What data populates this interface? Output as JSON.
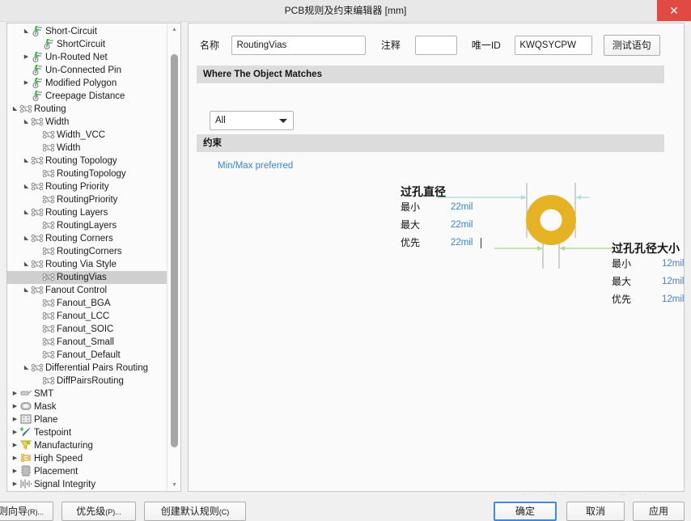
{
  "window": {
    "title": "PCB规则及约束编辑器 [mm]",
    "close_label": "✕"
  },
  "tree": {
    "nodes": [
      {
        "label": "Short-Circuit",
        "indent": 1,
        "arrow": "open",
        "icon": "short-circuit-icon"
      },
      {
        "label": "ShortCircuit",
        "indent": 2,
        "arrow": "none",
        "icon": "short-circuit-icon"
      },
      {
        "label": "Un-Routed Net",
        "indent": 1,
        "arrow": "closed",
        "icon": "short-circuit-icon"
      },
      {
        "label": "Un-Connected Pin",
        "indent": 1,
        "arrow": "none",
        "icon": "short-circuit-icon"
      },
      {
        "label": "Modified Polygon",
        "indent": 1,
        "arrow": "closed",
        "icon": "short-circuit-icon"
      },
      {
        "label": "Creepage Distance",
        "indent": 1,
        "arrow": "none",
        "icon": "short-circuit-icon"
      },
      {
        "label": "Routing",
        "indent": 0,
        "arrow": "open",
        "icon": "routing-icon"
      },
      {
        "label": "Width",
        "indent": 1,
        "arrow": "open",
        "icon": "routing-icon"
      },
      {
        "label": "Width_VCC",
        "indent": 2,
        "arrow": "none",
        "icon": "routing-icon"
      },
      {
        "label": "Width",
        "indent": 2,
        "arrow": "none",
        "icon": "routing-icon"
      },
      {
        "label": "Routing Topology",
        "indent": 1,
        "arrow": "open",
        "icon": "routing-icon"
      },
      {
        "label": "RoutingTopology",
        "indent": 2,
        "arrow": "none",
        "icon": "routing-icon"
      },
      {
        "label": "Routing Priority",
        "indent": 1,
        "arrow": "open",
        "icon": "routing-icon"
      },
      {
        "label": "RoutingPriority",
        "indent": 2,
        "arrow": "none",
        "icon": "routing-icon"
      },
      {
        "label": "Routing Layers",
        "indent": 1,
        "arrow": "open",
        "icon": "routing-icon"
      },
      {
        "label": "RoutingLayers",
        "indent": 2,
        "arrow": "none",
        "icon": "routing-icon"
      },
      {
        "label": "Routing Corners",
        "indent": 1,
        "arrow": "open",
        "icon": "routing-icon"
      },
      {
        "label": "RoutingCorners",
        "indent": 2,
        "arrow": "none",
        "icon": "routing-icon"
      },
      {
        "label": "Routing Via Style",
        "indent": 1,
        "arrow": "open",
        "icon": "routing-icon"
      },
      {
        "label": "RoutingVias",
        "indent": 2,
        "arrow": "none",
        "icon": "routing-icon",
        "selected": true
      },
      {
        "label": "Fanout Control",
        "indent": 1,
        "arrow": "open",
        "icon": "routing-icon"
      },
      {
        "label": "Fanout_BGA",
        "indent": 2,
        "arrow": "none",
        "icon": "routing-icon"
      },
      {
        "label": "Fanout_LCC",
        "indent": 2,
        "arrow": "none",
        "icon": "routing-icon"
      },
      {
        "label": "Fanout_SOIC",
        "indent": 2,
        "arrow": "none",
        "icon": "routing-icon"
      },
      {
        "label": "Fanout_Small",
        "indent": 2,
        "arrow": "none",
        "icon": "routing-icon"
      },
      {
        "label": "Fanout_Default",
        "indent": 2,
        "arrow": "none",
        "icon": "routing-icon"
      },
      {
        "label": "Differential Pairs Routing",
        "indent": 1,
        "arrow": "open",
        "icon": "routing-icon"
      },
      {
        "label": "DiffPairsRouting",
        "indent": 2,
        "arrow": "none",
        "icon": "routing-icon"
      },
      {
        "label": "SMT",
        "indent": 0,
        "arrow": "closed",
        "icon": "smt-icon"
      },
      {
        "label": "Mask",
        "indent": 0,
        "arrow": "closed",
        "icon": "mask-icon"
      },
      {
        "label": "Plane",
        "indent": 0,
        "arrow": "closed",
        "icon": "plane-icon"
      },
      {
        "label": "Testpoint",
        "indent": 0,
        "arrow": "closed",
        "icon": "testpoint-icon"
      },
      {
        "label": "Manufacturing",
        "indent": 0,
        "arrow": "closed",
        "icon": "manufacturing-icon"
      },
      {
        "label": "High Speed",
        "indent": 0,
        "arrow": "closed",
        "icon": "high-speed-icon"
      },
      {
        "label": "Placement",
        "indent": 0,
        "arrow": "closed",
        "icon": "placement-icon"
      },
      {
        "label": "Signal Integrity",
        "indent": 0,
        "arrow": "closed",
        "icon": "signal-integrity-icon"
      }
    ],
    "scroll_up": "▲",
    "scroll_down": "▼"
  },
  "form": {
    "name_label": "名称",
    "name_value": "RoutingVias",
    "comment_label": "注释",
    "comment_value": "",
    "unique_id_label": "唯一ID",
    "unique_id_value": "KWQSYCPW",
    "test_query_button": "测试语句"
  },
  "where_section": {
    "header": "Where The Object Matches",
    "scope_value": "All"
  },
  "constraint_section": {
    "header": "约束",
    "minmax_link": "Min/Max preferred",
    "via_diameter": {
      "title": "过孔直径",
      "rows": [
        {
          "label": "最小",
          "value": "22mil"
        },
        {
          "label": "最大",
          "value": "22mil"
        },
        {
          "label": "优先",
          "value": "22mil"
        }
      ]
    },
    "via_hole_size": {
      "title": "过孔孔径大小",
      "rows": [
        {
          "label": "最小",
          "value": "12mil"
        },
        {
          "label": "最大",
          "value": "12mil"
        },
        {
          "label": "优先",
          "value": "12mil"
        }
      ]
    }
  },
  "footer": {
    "wizard_button": "则向导",
    "wizard_mnemonic": "(R)...",
    "priority_button": "优先级",
    "priority_mnemonic": "(P)...",
    "default_rule_button": "创建默认规则",
    "default_rule_mnemonic": "(C)",
    "ok_button": "确定",
    "cancel_button": "取消",
    "apply_button": "应用"
  },
  "watermark": "https://blog.csdn.net/Davidysw",
  "colors": {
    "accent_blue": "#3b82d6",
    "via_gold": "#e6b325",
    "close_red": "#e04a43",
    "selection_gray": "#cfcfcf"
  }
}
